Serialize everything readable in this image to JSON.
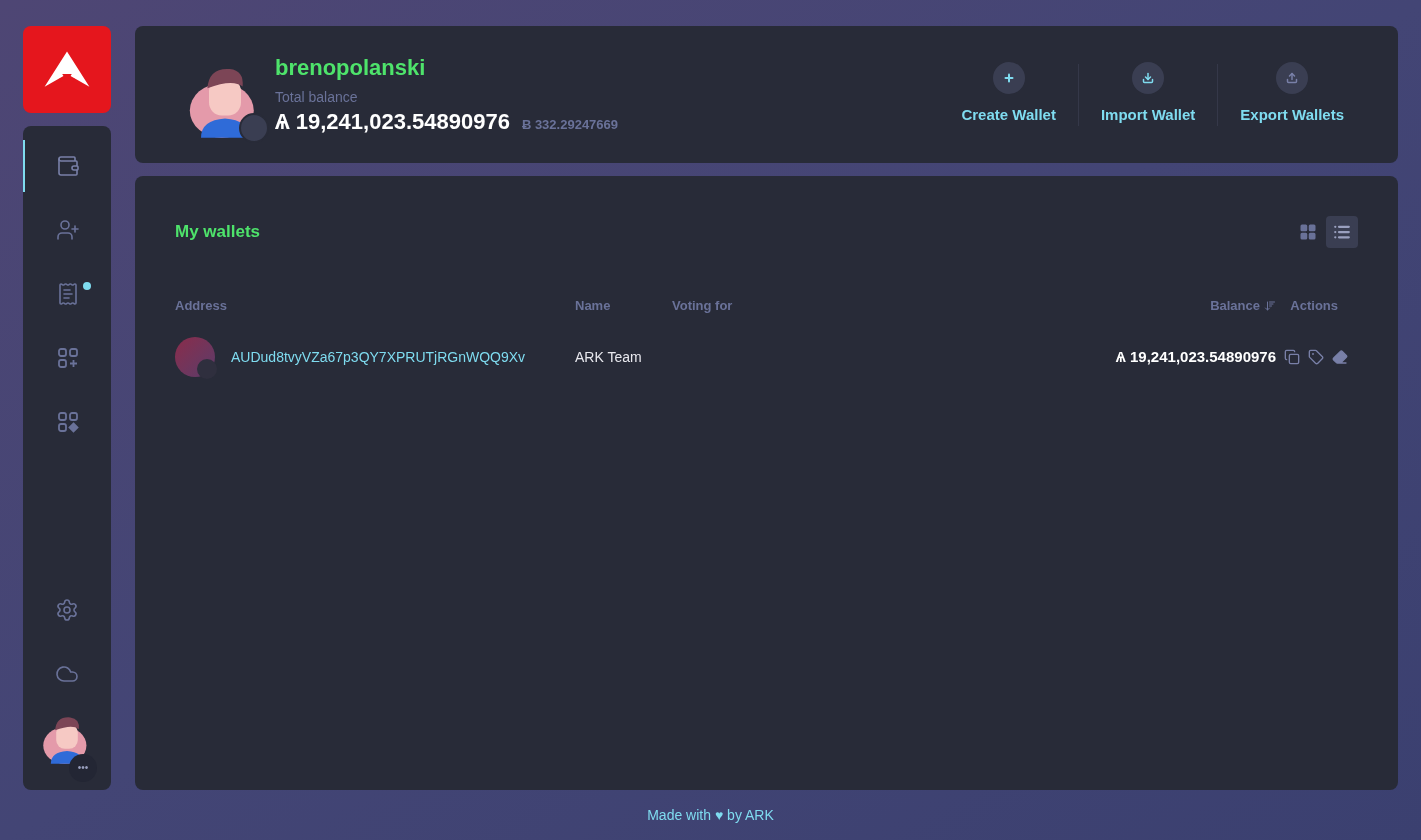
{
  "sidebar": {
    "items": [
      {
        "kind": "wallets",
        "selected": true,
        "badge": false
      },
      {
        "kind": "contacts",
        "selected": false,
        "badge": false
      },
      {
        "kind": "announcements",
        "selected": false,
        "badge": true
      },
      {
        "kind": "plugins",
        "selected": false,
        "badge": false
      },
      {
        "kind": "plugin-apps",
        "selected": false,
        "badge": false
      }
    ],
    "bottom_items": [
      {
        "kind": "settings"
      },
      {
        "kind": "network"
      }
    ],
    "profile_menu": "•••"
  },
  "header": {
    "username": "brenopolanski",
    "balance_label": "Total balance",
    "balance": "Ѧ 19,241,023.54890976",
    "alt_balance": "Ƀ 332.29247669",
    "actions": [
      {
        "kind": "create",
        "label": "Create Wallet"
      },
      {
        "kind": "import",
        "label": "Import Wallet"
      },
      {
        "kind": "export",
        "label": "Export Wallets"
      }
    ]
  },
  "wallets": {
    "title": "My wallets",
    "views": [
      {
        "kind": "grid",
        "selected": false
      },
      {
        "kind": "list",
        "selected": true
      }
    ],
    "columns": [
      "Address",
      "Name",
      "Voting for",
      "Balance",
      "Actions"
    ],
    "rows": [
      {
        "address": "AUDud8tvyVZa67p3QY7XPRUTjRGnWQQ9Xv",
        "name": "ARK Team",
        "balance": "Ѧ 19,241,023.54890976"
      }
    ]
  },
  "footer": {
    "text": "Made with ♥ by ARK"
  }
}
